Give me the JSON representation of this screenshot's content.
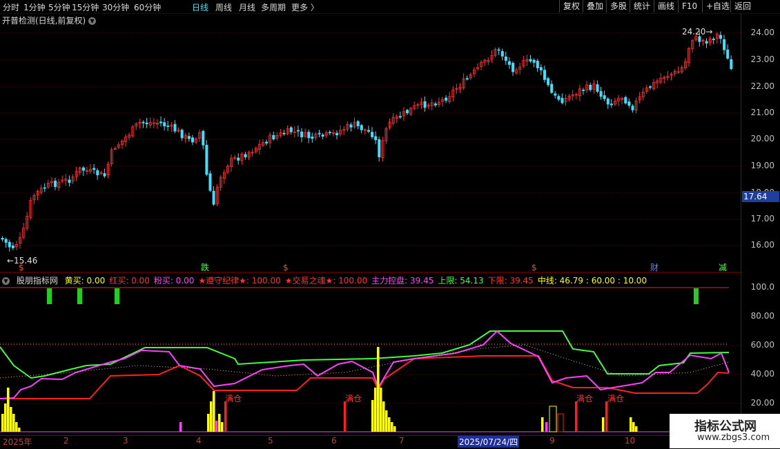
{
  "toolbar": {
    "timeframes": [
      "分时",
      "1分钟",
      "5分钟",
      "15分钟",
      "30分钟",
      "60分钟",
      "日线",
      "周线",
      "月线",
      "多周期",
      "更多"
    ],
    "selected": "日线",
    "buttons": [
      "复权",
      "叠加",
      "多股",
      "统计",
      "画线",
      "F10",
      "+自选",
      "返回"
    ]
  },
  "main_title": "开普检测(日线,前复权)",
  "price_axis": [
    "24.00",
    "23.00",
    "22.00",
    "21.00",
    "20.00",
    "19.00",
    "18.00",
    "17.00",
    "16.00"
  ],
  "current_price": "17.64",
  "annotations": {
    "high": "24.20",
    "low": "15.46"
  },
  "event_markers": [
    "$",
    "跌",
    "$",
    "$",
    "财",
    "减"
  ],
  "indicator": {
    "name": "股朋指标网",
    "items": [
      {
        "label": "黄买:",
        "value": "0.00",
        "color": "#ffff00"
      },
      {
        "label": "红买:",
        "value": "0.00",
        "color": "#ff3030"
      },
      {
        "label": "粉买:",
        "value": "0.00",
        "color": "#ff40ff"
      },
      {
        "label": "★遵守纪律★:",
        "value": "100.00",
        "color": "#ff3030"
      },
      {
        "label": "★交易之魂★:",
        "value": "100.00",
        "color": "#ff3030"
      },
      {
        "label": "主力控盘:",
        "value": "39.45",
        "color": "#ff40ff"
      },
      {
        "label": "上限:",
        "value": "54.13",
        "color": "#40ff40"
      },
      {
        "label": "下限:",
        "value": "39.45",
        "color": "#ff3030"
      },
      {
        "label": "中线:",
        "value": "46.79 : 60.00 : 10.00",
        "color": "#ffff00"
      }
    ],
    "axis": [
      "100.0",
      "80.00",
      "60.00",
      "40.00",
      "20.00"
    ],
    "tags": [
      "满仓",
      "满仓",
      "满仓",
      "满仓"
    ]
  },
  "x_axis": {
    "labels": [
      "2025年",
      "2",
      "3",
      "4",
      "5",
      "6",
      "7",
      "9",
      "10"
    ],
    "highlight": "2025/07/24/四"
  },
  "watermark": {
    "line1": "指标公式网",
    "line2": "www.zbgs3.com"
  },
  "colors": {
    "up": "#ff3030",
    "down": "#3fe0ff",
    "upper": "#40ff40",
    "lower": "#ff2020",
    "main": "#ff40ff",
    "mid": "#d0d0a0"
  }
}
